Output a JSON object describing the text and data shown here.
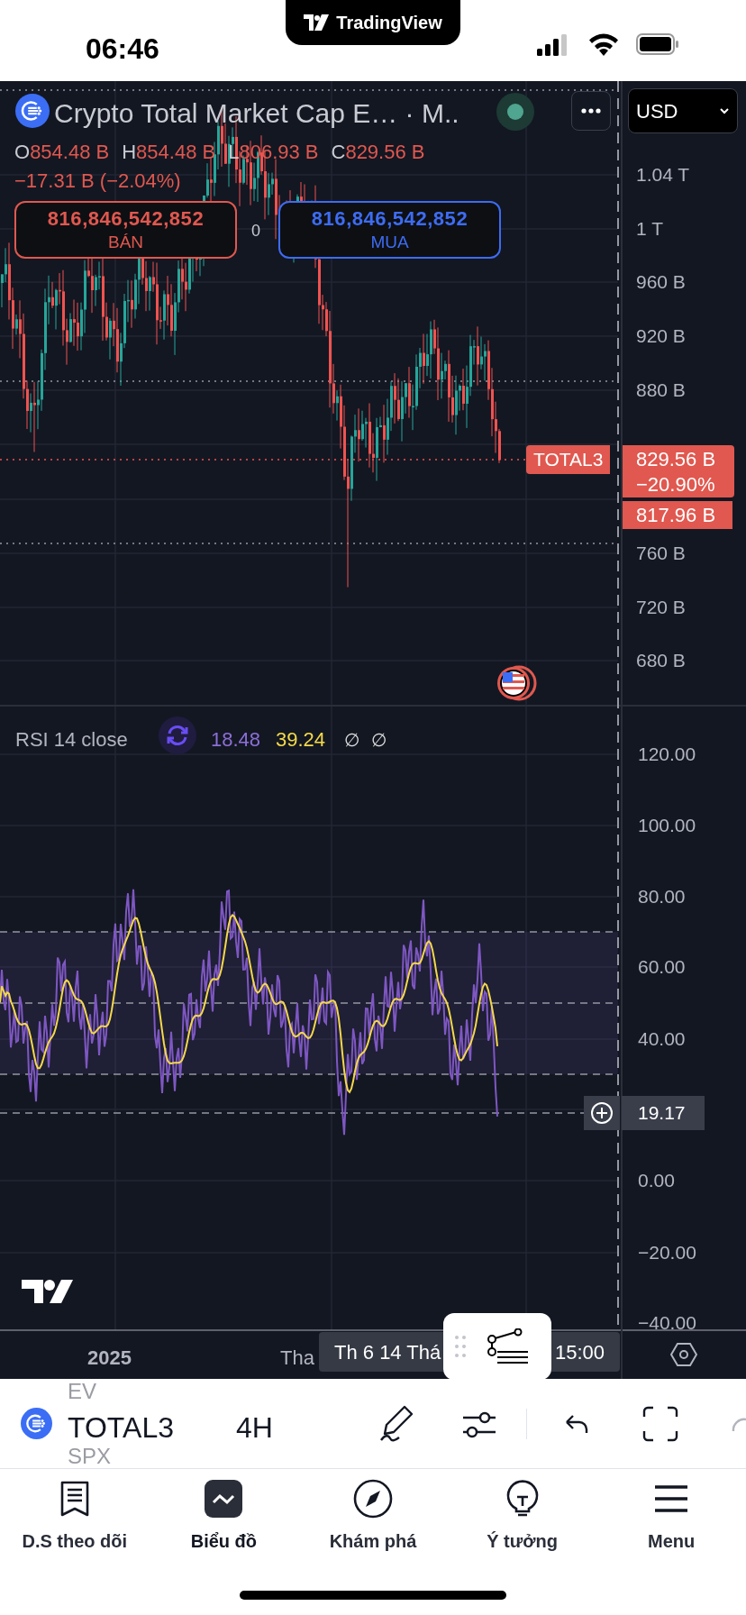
{
  "status_bar": {
    "time": "06:46",
    "app_pill": "TradingView"
  },
  "chart": {
    "title": "Crypto Total Market Cap E… · M..",
    "currency": "USD",
    "ohlc": [
      {
        "letter": "O",
        "value": "854.48 B"
      },
      {
        "letter": "H",
        "value": "854.48 B"
      },
      {
        "letter": "L",
        "value": "806.93 B"
      },
      {
        "letter": "C",
        "value": "829.56 B"
      }
    ],
    "change": "−17.31 B (−2.04%)",
    "sell": {
      "price": "816,846,542,852",
      "label": "BÁN"
    },
    "spread": "0",
    "buy": {
      "price": "816,846,542,852",
      "label": "MUA"
    },
    "price_axis": [
      "1.04 T",
      "1 T",
      "960 B",
      "920 B",
      "880 B",
      "760 B",
      "720 B",
      "680 B"
    ],
    "symbol_tag": "TOTAL3",
    "price_tag": "829.56 B",
    "change_tag": "−20.90%",
    "price_tag_2": "817.96 B"
  },
  "rsi": {
    "title": "RSI 14 close",
    "value": "18.48",
    "ma_value": "39.24",
    "extra": [
      "∅",
      "∅"
    ],
    "axis": [
      "120.00",
      "100.00",
      "80.00",
      "60.00",
      "40.00",
      "0.00",
      "−20.00",
      "−40.00"
    ],
    "crosshair_value": "19.17"
  },
  "time_axis": {
    "year": "2025",
    "partial_label": "Tha",
    "crosshair_time": "Th 6 14 Thá",
    "crosshair_time_end": "15:00"
  },
  "toolbar": {
    "symbol": "TOTAL3",
    "interval": "4H",
    "picker_above": "EV",
    "picker_below": "SPX"
  },
  "tabs": [
    {
      "label": "D.S theo dõi",
      "selected": false
    },
    {
      "label": "Biểu đồ",
      "selected": true
    },
    {
      "label": "Khám phá",
      "selected": false
    },
    {
      "label": "Ý tưởng",
      "selected": false
    },
    {
      "label": "Menu",
      "selected": false
    }
  ]
}
